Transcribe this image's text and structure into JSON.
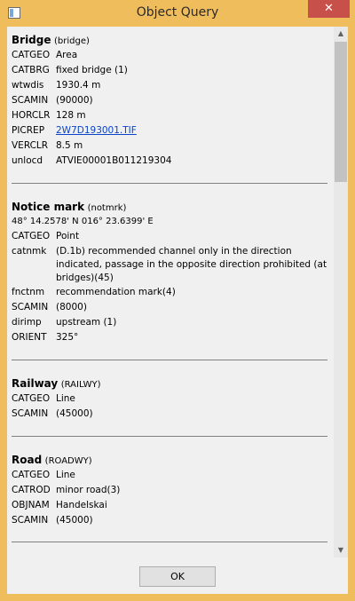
{
  "window": {
    "title": "Object Query",
    "close_glyph": "✕"
  },
  "sections": [
    {
      "name": "Bridge",
      "code": "(bridge)",
      "attrs": [
        {
          "key": "CATGEO",
          "value": "Area"
        },
        {
          "key": "CATBRG",
          "value": "fixed bridge (1)"
        },
        {
          "key": "wtwdis",
          "value": "1930.4 m"
        },
        {
          "key": "SCAMIN",
          "value": "(90000)"
        },
        {
          "key": "HORCLR",
          "value": "128 m"
        },
        {
          "key": "PICREP",
          "value": "2W7D193001.TIF",
          "link": true
        },
        {
          "key": "VERCLR",
          "value": "8.5 m"
        },
        {
          "key": "unlocd",
          "value": "ATVIE00001B011219304"
        }
      ]
    },
    {
      "name": "Notice mark",
      "code": "(notmrk)",
      "coords": "48° 14.2578' N 016° 23.6399' E",
      "attrs": [
        {
          "key": "CATGEO",
          "value": "Point"
        },
        {
          "key": "catnmk",
          "value": "(D.1b) recommended channel only in the direction indicated, passage in the opposite direction prohibited (at bridges)(45)"
        },
        {
          "key": "fnctnm",
          "value": "recommendation mark(4)"
        },
        {
          "key": "SCAMIN",
          "value": "(8000)"
        },
        {
          "key": "dirimp",
          "value": "upstream (1)"
        },
        {
          "key": "ORIENT",
          "value": "325°"
        }
      ]
    },
    {
      "name": "Railway",
      "code": "(RAILWY)",
      "attrs": [
        {
          "key": "CATGEO",
          "value": "Line"
        },
        {
          "key": "SCAMIN",
          "value": "(45000)"
        }
      ]
    },
    {
      "name": "Road",
      "code": "(ROADWY)",
      "attrs": [
        {
          "key": "CATGEO",
          "value": "Line"
        },
        {
          "key": "CATROD",
          "value": "minor road(3)"
        },
        {
          "key": "OBJNAM",
          "value": "Handelskai"
        },
        {
          "key": "SCAMIN",
          "value": "(45000)"
        }
      ]
    }
  ],
  "scrollbar": {
    "up_glyph": "▲",
    "down_glyph": "▼"
  },
  "footer": {
    "ok_label": "OK"
  }
}
